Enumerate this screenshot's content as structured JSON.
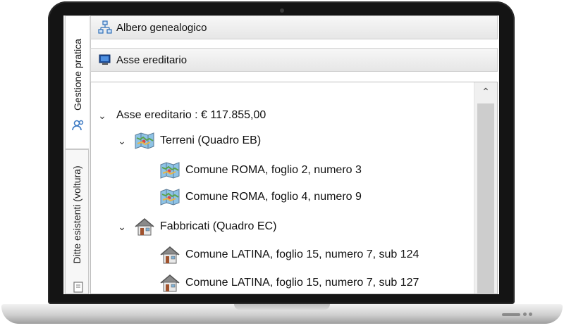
{
  "side_tabs": {
    "practice": "Gestione pratica",
    "existing": "Ditte esistenti (voltura)"
  },
  "header": {
    "family_tree": "Albero genealogico",
    "inheritance": "Asse ereditario"
  },
  "tree": {
    "root_label": "Asse ereditario : € 117.855,00",
    "land_group": "Terreni (Quadro EB)",
    "land_items": [
      "Comune ROMA, foglio 2, numero 3",
      "Comune ROMA, foglio 4, numero 9"
    ],
    "building_group": "Fabbricati (Quadro EC)",
    "building_items": [
      "Comune LATINA, foglio 15, numero 7, sub 124",
      "Comune LATINA, foglio 15, numero 7, sub 127"
    ]
  }
}
